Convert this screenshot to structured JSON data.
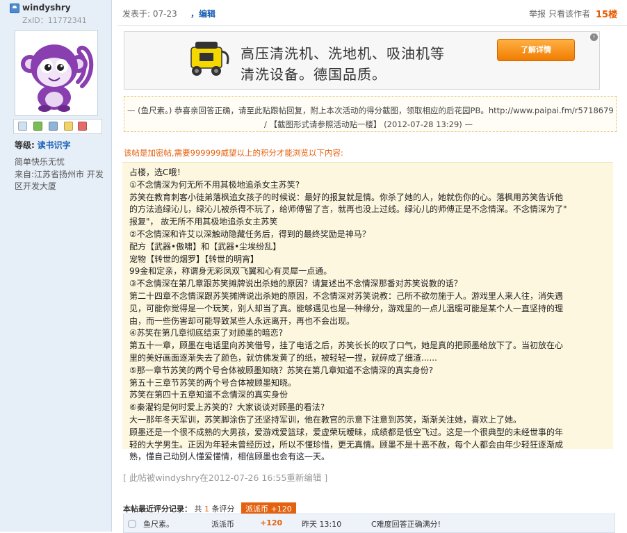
{
  "user": {
    "name": "windyshry",
    "zxid": "ZxID：11772341",
    "level_label": "等级:",
    "level_value": "读书识字",
    "signature": "简单快乐无忧",
    "location": "来自:江苏省扬州市 开发区开发大厦"
  },
  "post": {
    "posted_label": "发表于:",
    "posted_date": "07-23",
    "edit_link": "，编辑",
    "report": "举报",
    "author_only": "只看该作者",
    "floor": "15楼"
  },
  "ad": {
    "line1": "高压清洗机、洗地机、吸油机等",
    "line2": "清洗设备。德国品质。",
    "button": "了解详情",
    "close": "i"
  },
  "quote": {
    "line1": "— (鱼尺素。) 恭喜亲回答正确，请至此贴跟帖回复，附上本次活动的得分截图，领取相应的后花园PB。http://www.paipai.fm/r5718679",
    "line2": "/ 【截图形式请参照活动贴一楼】 (2012-07-28 13:29) —"
  },
  "notice": "该帖是加密帖,需要999999威望以上的积分才能浏览以下内容:",
  "content_lines": [
    "占楼，选C哦！",
    "①不念情深为何无所不用其极地追杀女主苏笑?",
    "苏笑在教育刺客小徒弟落枫追女孩子的时候说：最好的报复就是情。你杀了她的人，她就伤你的心。落枫用苏笑告诉他",
    "的方法追绿沁儿，绿沁儿被杀得不玩了，给师傅留了言，就再也没上过线。绿沁儿的师傅正是不念情深。不念情深为了\"",
    "报复\"，  故无所不用其极地追杀女主苏笑",
    "②不念情深和许艾以深触动隐藏任务后，得到的最终奖励是神马？",
    "配方【武器•傲啸】和【武器•尘埃纷乱】",
    "宠物【转世的烟罗】【转世的明宵】",
    "99金和定亲，称谓身无彩凤双飞翼和心有灵犀一点通。",
    "③不念情深在第几章跟苏笑摊牌说出杀她的原因？请复述出不念情深那番对苏笑说教的话？",
    "第二十四章不念情深跟苏笑摊牌说出杀她的原因，不念情深对苏笑说教：己所不欲勿施于人。游戏里人来人往，消失遇",
    "见，可能你觉得是一个玩笑，别人却当了真。能够遇见也是一种缘分，游戏里的一点儿温暖可能是某个人一直坚持的理",
    "由，而一些伤害却可能导致某些人永远离开，再也不会出现。",
    "④苏笑在第几章彻底结束了对顾墨的暗恋?",
    "第五十一章，顾墨在电话里向苏笑借号，挂了电话之后，苏笑长长的叹了口气，她是真的把顾墨给放下了。当初放在心",
    "里的美好画面逐渐失去了颜色，就仿佛发黄了的纸，被轻轻一捏，就碎成了细渣......",
    "⑤那一章节苏笑的两个号合体被顾墨知晓？苏笑在第几章知道不念情深的真实身份?",
    "第五十三章节苏笑的两个号合体被顾墨知晓。",
    "苏笑在第四十五章知道不念情深的真实身份",
    "⑥秦濯钧是何时爱上苏笑的？大家谈谈对顾墨的看法?",
    "大一那年冬天军训，苏笑脚涂伤了还坚持军训，他在教官的示意下注意到苏笑，渐渐关注她，喜欢上了她。",
    "顾墨还是一个很不成熟的大男孩，爱游戏爱篮球，爱虚荣玩暧昧，成绩都是低空飞过。这是一个很典型的未经世事的年",
    "轻的大学男生。正因为年轻未曾经历过，所以不懂珍惜，更无真情。顾墨不是十恶不赦，每个人都会由年少轻狂逐渐成",
    "熟，懂自己动别人懂爱懂情，相信顾墨也会有这一天。"
  ],
  "edit_note": "[ 此帖被windyshry在2012-07-26 16:55重新编辑 ]",
  "rating": {
    "title": "本帖最近评分记录：",
    "count_prefix": "共",
    "count": "1",
    "count_suffix": "条评分",
    "badge": "派派币 +120",
    "row": {
      "user": "鱼尺素。",
      "currency": "派派币",
      "amount": "+120",
      "time": "昨天 13:10",
      "reason": "C难度回答正确满分!"
    }
  },
  "colors": {
    "accent_orange": "#e4620f",
    "link_blue": "#1a5fb4",
    "sidebar_bg": "#e6eef7",
    "content_bg": "#fdf7df"
  }
}
